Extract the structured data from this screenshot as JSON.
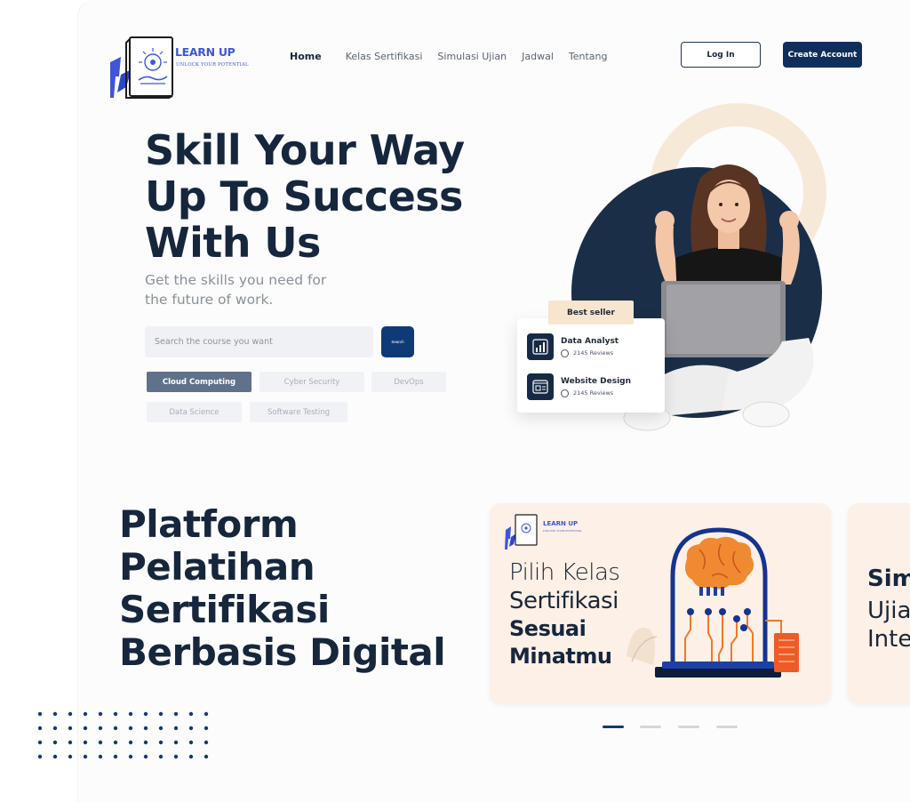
{
  "brand": {
    "name": "LEARN UP",
    "tagline": "UNLOCK YOUR POTENTIAL"
  },
  "nav": {
    "items": [
      "Home",
      "Kelas Sertifikasi",
      "Simulasi Ujian",
      "Jadwal",
      "Tentang"
    ],
    "active": "Home"
  },
  "header": {
    "login_label": "Log In",
    "create_label": "Create Account"
  },
  "hero": {
    "title_lines": [
      "Skill Your Way",
      "Up To Success",
      "With Us"
    ],
    "subtitle_lines": [
      "Get the skills you need for",
      "the future of work."
    ],
    "search_placeholder": "Search the course you want",
    "search_button": "Search",
    "chips": [
      "Cloud Computing",
      "Cyber Security",
      "DevOps",
      "Data Science",
      "Software Testing"
    ],
    "active_chip": "Cloud Computing"
  },
  "bestseller": {
    "tag": "Best seller",
    "courses": [
      {
        "name": "Data Analyst",
        "reviews": "2145 Reviews",
        "icon": "chart-icon"
      },
      {
        "name": "Website Design",
        "reviews": "2145 Reviews",
        "icon": "web-design-icon"
      }
    ]
  },
  "platform": {
    "title_lines": [
      "Platform",
      "Pelatihan",
      "Sertifikasi",
      "Berbasis Digital"
    ]
  },
  "cards": [
    {
      "logo_name": "LEARN UP",
      "logo_tagline": "UNLOCK YOUR POTENTIAL",
      "lines": [
        "Pilih Kelas",
        "Sertifikasi",
        "Sesuai",
        "Minatmu"
      ]
    },
    {
      "lines": [
        "Sim",
        "Ujia",
        "Inte"
      ]
    }
  ],
  "carousel": {
    "pages": 4,
    "active_index": 0
  },
  "colors": {
    "brand_blue": "#3f56d8",
    "navy": "#0f2e5c",
    "heading": "#16263d",
    "card_bg": "#fdf0e6",
    "accent_orange": "#f0782a"
  }
}
